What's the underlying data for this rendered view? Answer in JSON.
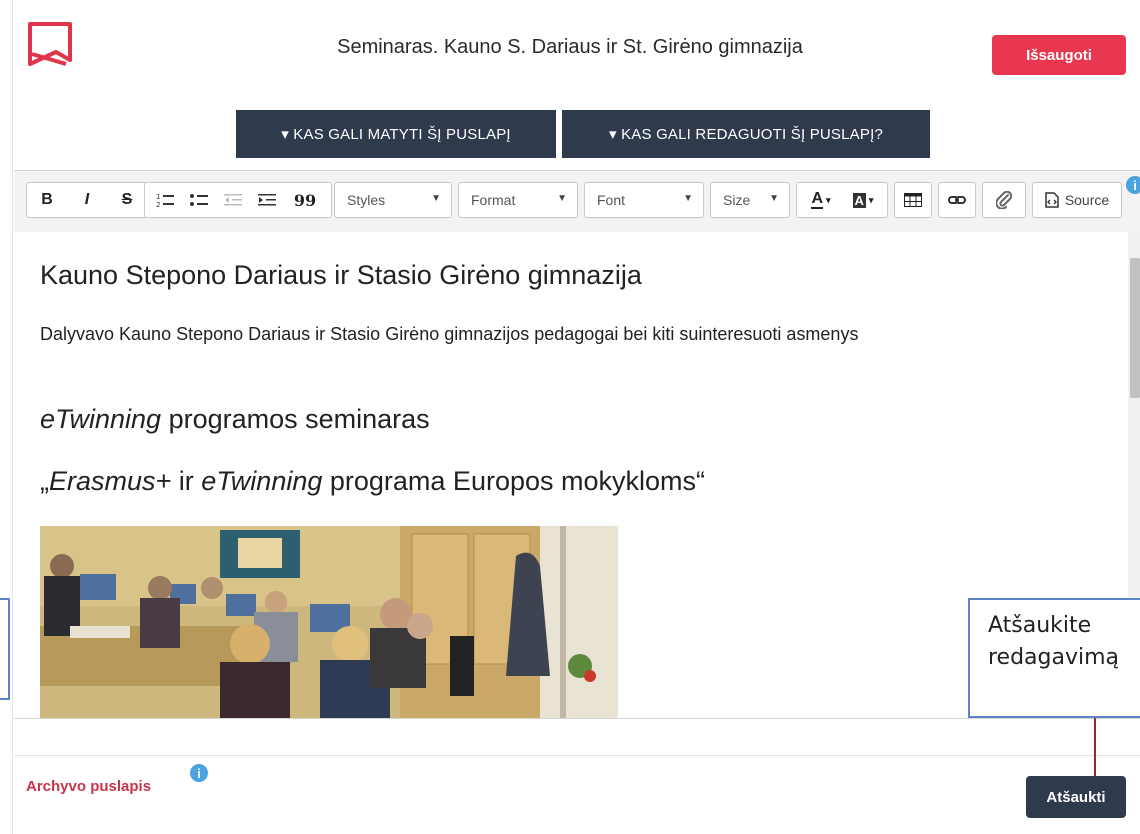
{
  "header": {
    "title": "Seminaras. Kauno S. Dariaus ir St. Girėno gimnazija",
    "save_label": "Išsaugoti"
  },
  "permissions": {
    "view_label": "▾ KAS GALI MATYTI ŠĮ PUSLAPĮ",
    "edit_label": "▾ KAS GALI REDAGUOTI ŠĮ PUSLAPĮ?"
  },
  "toolbar": {
    "bold": "B",
    "italic": "I",
    "strike": "S",
    "blockquote": "99",
    "styles": "Styles",
    "format": "Format",
    "font": "Font",
    "size": "Size",
    "text_color": "A",
    "bg_color": "A",
    "source": "Source",
    "info": "i"
  },
  "content": {
    "heading": "Kauno Stepono Dariaus ir Stasio Girėno gimnazija",
    "paragraph": "Dalyvavo Kauno Stepono Dariaus ir Stasio Girėno gimnazijos pedagogai bei kiti suinteresuoti asmenys",
    "h2_italic": "eTwinning",
    "h2_rest": " programos seminaras",
    "h3_open": "„",
    "h3_italic1": "Erasmus+",
    "h3_mid": " ir ",
    "h3_italic2": "eTwinning",
    "h3_rest": " programa Europos mokykloms“"
  },
  "footer": {
    "archive_label": "Archyvo puslapis",
    "info": "i",
    "cancel_label": "Atšaukti"
  },
  "annotation": {
    "line1": "Atšaukite",
    "line2": "redagavimą"
  },
  "colors": {
    "accent_red": "#e8374f",
    "dark_navy": "#2f3a4d",
    "archive_red": "#c8344a",
    "info_blue": "#4aa3df",
    "callout_border": "#5b84c4"
  }
}
